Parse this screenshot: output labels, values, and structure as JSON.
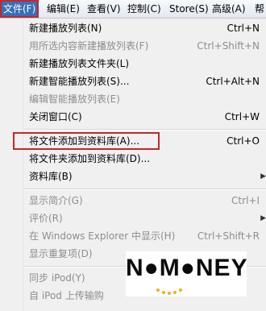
{
  "menubar": {
    "items": [
      "文件(F)",
      "编辑(E)",
      "查看(V)",
      "控制(C)",
      "Store(S)",
      "高级(A)",
      "帮"
    ]
  },
  "file_menu": {
    "items": [
      {
        "label": "新建播放列表(N)",
        "shortcut": "Ctrl+N",
        "enabled": true
      },
      {
        "label": "用所选内容新建播放列表(F)",
        "shortcut": "Ctrl+Shift+N",
        "enabled": false
      },
      {
        "label": "新建播放列表文件夹(L)",
        "shortcut": "",
        "enabled": true
      },
      {
        "label": "新建智能播放列表(S)...",
        "shortcut": "Ctrl+Alt+N",
        "enabled": true
      },
      {
        "label": "编辑智能播放列表(E)",
        "shortcut": "",
        "enabled": false
      },
      {
        "label": "关闭窗口(C)",
        "shortcut": "Ctrl+W",
        "enabled": true
      },
      {
        "label": "将文件添加到资料库(A)...",
        "shortcut": "Ctrl+O",
        "enabled": true,
        "highlighted": true
      },
      {
        "label": "将文件夹添加到资料库(D)...",
        "shortcut": "",
        "enabled": true
      },
      {
        "label": "资料库(B)",
        "shortcut": "",
        "enabled": true,
        "submenu": true
      },
      {
        "label": "显示简介(G)",
        "shortcut": "Ctrl+I",
        "enabled": false
      },
      {
        "label": "评价(R)",
        "shortcut": "",
        "enabled": false,
        "submenu": true
      },
      {
        "label": "在 Windows Explorer 中显示(H)",
        "shortcut": "Ctrl+Shift+R",
        "enabled": false
      },
      {
        "label": "显示重复项(D)",
        "shortcut": "",
        "enabled": false
      },
      {
        "label": "同步 iPod(Y)",
        "shortcut": "",
        "enabled": false
      },
      {
        "label": "自 iPod 上传输购",
        "shortcut": "",
        "enabled": false
      }
    ],
    "submenu_arrow": "▶"
  },
  "watermark": {
    "text": "N●M●NEY"
  }
}
